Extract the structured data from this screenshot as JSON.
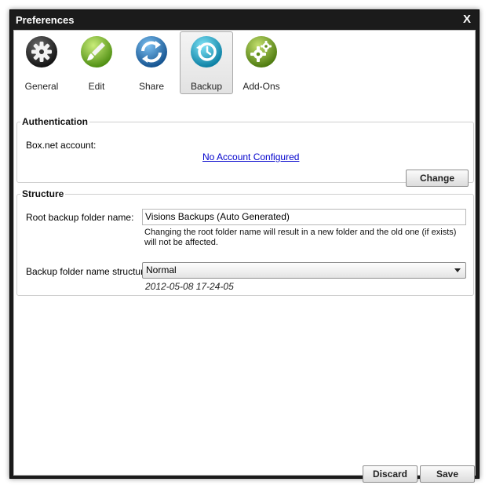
{
  "window": {
    "title": "Preferences",
    "close_label": "X"
  },
  "toolbar": {
    "items": [
      {
        "label": "General",
        "icon": "gear-icon",
        "color": "#2a2a2a",
        "active": false
      },
      {
        "label": "Edit",
        "icon": "brush-icon",
        "color": "#7fbf2a",
        "active": false
      },
      {
        "label": "Share",
        "icon": "share-arrows-icon",
        "color": "#1f6fb5",
        "active": false
      },
      {
        "label": "Backup",
        "icon": "backup-clock-icon",
        "color": "#1aa6c8",
        "active": true
      },
      {
        "label": "Add-Ons",
        "icon": "addons-gears-icon",
        "color": "#6f9a1e",
        "active": false
      }
    ]
  },
  "authentication": {
    "legend": "Authentication",
    "account_label": "Box.net account:",
    "account_link": "No Account Configured",
    "change_label": "Change"
  },
  "structure": {
    "legend": "Structure",
    "root_label": "Root backup folder name:",
    "root_value": "Visions Backups (Auto Generated)",
    "root_note": "Changing the root folder name will result in a new folder and the old one (if exists) will not be affected.",
    "name_structure_label": "Backup folder name structure:",
    "name_structure_value": "Normal",
    "preview": "2012-05-08 17-24-05"
  },
  "footer": {
    "discard_label": "Discard",
    "save_label": "Save"
  }
}
